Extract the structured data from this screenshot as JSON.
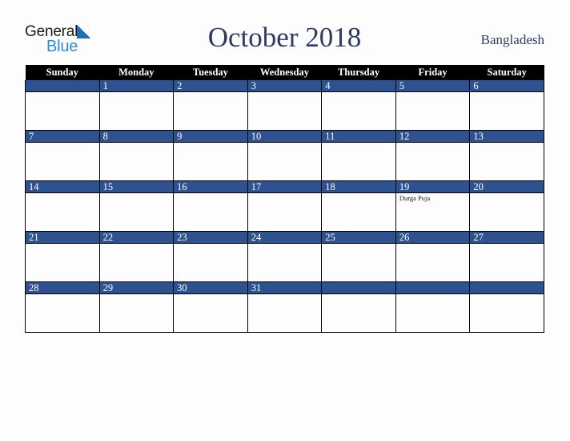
{
  "brand": {
    "name_top": "General",
    "name_bottom": "Blue",
    "top_color": "#1b1b1b",
    "bottom_color": "#2a8fd4",
    "triangle_color": "#1f6fb5"
  },
  "header": {
    "title": "October 2018",
    "region": "Bangladesh",
    "title_color": "#2b3b63"
  },
  "theme": {
    "header_row_bg": "#000000",
    "header_row_text": "#ffffff",
    "day_band_bg": "#2e5190",
    "day_band_text": "#ffffff",
    "cell_bg": "#fdfdfd",
    "border": "#000000",
    "page_bg": "#fdfdfd"
  },
  "weekday_headers": [
    "Sunday",
    "Monday",
    "Tuesday",
    "Wednesday",
    "Thursday",
    "Friday",
    "Saturday"
  ],
  "weeks": [
    [
      {
        "date": "",
        "events": []
      },
      {
        "date": "1",
        "events": []
      },
      {
        "date": "2",
        "events": []
      },
      {
        "date": "3",
        "events": []
      },
      {
        "date": "4",
        "events": []
      },
      {
        "date": "5",
        "events": []
      },
      {
        "date": "6",
        "events": []
      }
    ],
    [
      {
        "date": "7",
        "events": []
      },
      {
        "date": "8",
        "events": []
      },
      {
        "date": "9",
        "events": []
      },
      {
        "date": "10",
        "events": []
      },
      {
        "date": "11",
        "events": []
      },
      {
        "date": "12",
        "events": []
      },
      {
        "date": "13",
        "events": []
      }
    ],
    [
      {
        "date": "14",
        "events": []
      },
      {
        "date": "15",
        "events": []
      },
      {
        "date": "16",
        "events": []
      },
      {
        "date": "17",
        "events": []
      },
      {
        "date": "18",
        "events": []
      },
      {
        "date": "19",
        "events": [
          "Durga Puja"
        ]
      },
      {
        "date": "20",
        "events": []
      }
    ],
    [
      {
        "date": "21",
        "events": []
      },
      {
        "date": "22",
        "events": []
      },
      {
        "date": "23",
        "events": []
      },
      {
        "date": "24",
        "events": []
      },
      {
        "date": "25",
        "events": []
      },
      {
        "date": "26",
        "events": []
      },
      {
        "date": "27",
        "events": []
      }
    ],
    [
      {
        "date": "28",
        "events": []
      },
      {
        "date": "29",
        "events": []
      },
      {
        "date": "30",
        "events": []
      },
      {
        "date": "31",
        "events": []
      },
      {
        "date": "",
        "events": []
      },
      {
        "date": "",
        "events": []
      },
      {
        "date": "",
        "events": []
      }
    ]
  ]
}
